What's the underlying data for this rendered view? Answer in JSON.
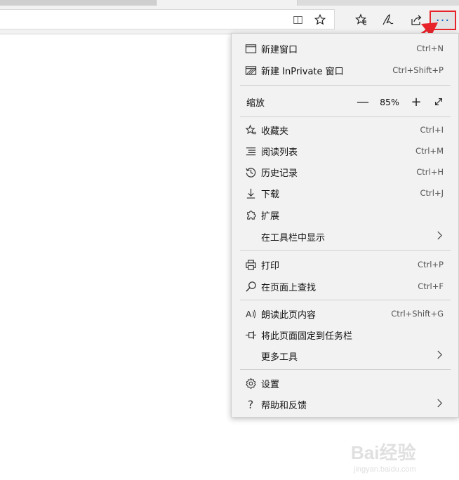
{
  "toolbar": {
    "icons": [
      "reading-view-icon",
      "favorite-star-icon",
      "favorites-hub-icon",
      "pen-icon",
      "share-icon",
      "more-icon"
    ],
    "more_label": "···"
  },
  "menu": {
    "new_window": {
      "label": "新建窗口",
      "shortcut": "Ctrl+N"
    },
    "new_inprivate": {
      "label": "新建 InPrivate 窗口",
      "shortcut": "Ctrl+Shift+P"
    },
    "zoom": {
      "label": "缩放",
      "minus": "—",
      "value": "85%",
      "plus": "+"
    },
    "favorites": {
      "label": "收藏夹",
      "shortcut": "Ctrl+I"
    },
    "reading_list": {
      "label": "阅读列表",
      "shortcut": "Ctrl+M"
    },
    "history": {
      "label": "历史记录",
      "shortcut": "Ctrl+H"
    },
    "downloads": {
      "label": "下载",
      "shortcut": "Ctrl+J"
    },
    "extensions": {
      "label": "扩展"
    },
    "show_in_toolbar": {
      "label": "在工具栏中显示"
    },
    "print": {
      "label": "打印",
      "shortcut": "Ctrl+P"
    },
    "find": {
      "label": "在页面上查找",
      "shortcut": "Ctrl+F"
    },
    "read_aloud": {
      "label": "朗读此页内容",
      "shortcut": "Ctrl+Shift+G"
    },
    "pin_taskbar": {
      "label": "将此页面固定到任务栏"
    },
    "more_tools": {
      "label": "更多工具"
    },
    "settings": {
      "label": "设置"
    },
    "help": {
      "label": "帮助和反馈"
    }
  },
  "watermark": {
    "brand": "Bai经验",
    "url": "jingyan.baidu.com"
  },
  "colors": {
    "highlight_border": "#e8242a",
    "arrow": "#e8242a",
    "more_icon": "#0b63c5",
    "menu_bg": "#f2f2f2"
  }
}
